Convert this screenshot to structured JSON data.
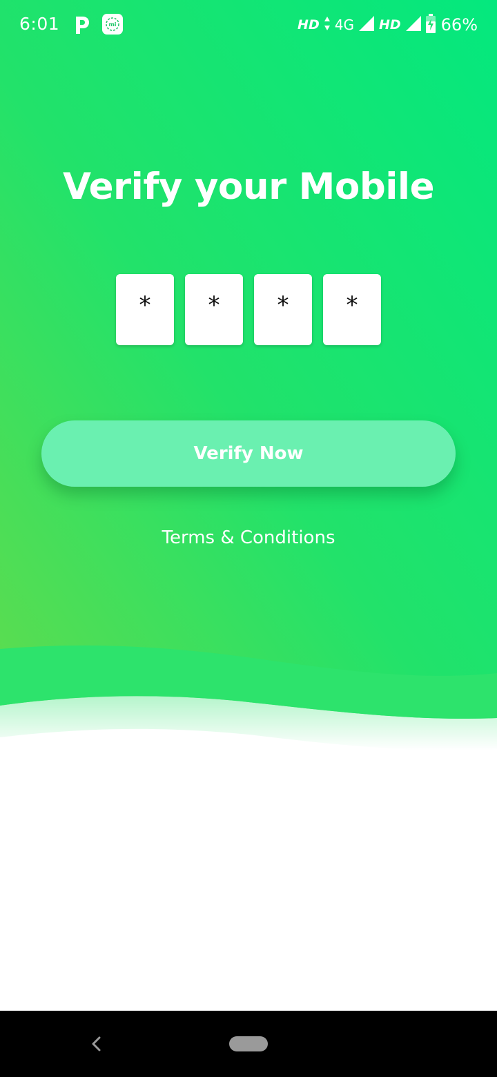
{
  "status_bar": {
    "time": "6:01",
    "hd_label_1": "HD",
    "network_type": "4G",
    "hd_label_2": "HD",
    "battery_percent": "66%",
    "icons": [
      "p-app-icon",
      "mi-app-icon",
      "data-arrows-icon",
      "signal-icon",
      "battery-charging-icon"
    ]
  },
  "verify": {
    "title": "Verify your Mobile",
    "pin_digits": [
      "*",
      "*",
      "*",
      "*"
    ],
    "button_label": "Verify Now",
    "terms_link": "Terms & Conditions"
  },
  "nav_bar": {
    "icons": [
      "back-icon",
      "home-pill-icon"
    ]
  },
  "colors": {
    "gradient_top": "#04e87e",
    "gradient_bottom_left": "#5fdc4e",
    "button_fill": "#6af0b0",
    "wave": "#2de36c",
    "text": "#ffffff",
    "nav_background": "#000000"
  }
}
